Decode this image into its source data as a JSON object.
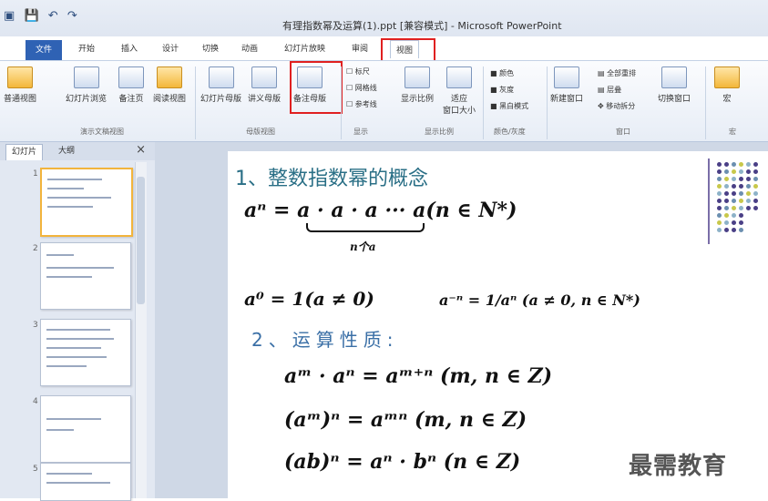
{
  "window": {
    "title": "有理指数幂及运算(1).ppt [兼容模式] - Microsoft PowerPoint"
  },
  "ribbon_tabs": [
    {
      "label": "文件",
      "active": false
    },
    {
      "label": "开始",
      "active": false
    },
    {
      "label": "插入",
      "active": false
    },
    {
      "label": "设计",
      "active": false
    },
    {
      "label": "切换",
      "active": false
    },
    {
      "label": "动画",
      "active": false
    },
    {
      "label": "幻灯片放映",
      "active": false
    },
    {
      "label": "审阅",
      "active": false
    },
    {
      "label": "视图",
      "active": true
    }
  ],
  "ribbon": {
    "normal": "普通视图",
    "sorter": "幻灯片浏览",
    "notes": "备注页",
    "reading": "阅读视图",
    "slide_master": "幻灯片母版",
    "handout_master": "讲义母版",
    "notes_master": "备注母版",
    "ruler": "标尺",
    "gridlines": "网格线",
    "guides": "参考线",
    "zoom": "显示比例",
    "fit_window": "适应",
    "fit_window_2": "窗口大小",
    "color": "颜色",
    "grayscale": "灰度",
    "bw": "黑白模式",
    "new_window": "新建窗口",
    "arrange_all": "全部重排",
    "cascade": "层叠",
    "move_split": "移动拆分",
    "switch_window": "切换窗口",
    "macros": "宏",
    "group_pres_views": "演示文稿视图",
    "group_master_views": "母版视图",
    "group_show": "显示",
    "group_zoom": "显示比例",
    "group_color": "颜色/灰度",
    "group_window": "窗口",
    "group_macros": "宏"
  },
  "left_pane": {
    "tab_slides": "幻灯片",
    "tab_outline": "大纲",
    "close": "×",
    "slide_numbers": [
      "1",
      "2",
      "3",
      "4",
      "5"
    ]
  },
  "slide": {
    "heading1": "1、整数指数幂的概念",
    "eq_power_def": "aⁿ = a · a · a ··· a(n ∈ N*)",
    "underbrace_label": "n个a",
    "eq_zero": "a⁰ = 1(a ≠ 0)",
    "eq_negative": "a⁻ⁿ = 1/aⁿ (a ≠ 0, n ∈ N*)",
    "heading2": "2、运算性质:",
    "rule1": "aᵐ · aⁿ = aᵐ⁺ⁿ (m, n ∈ Z)",
    "rule2": "(aᵐ)ⁿ = aᵐⁿ (m, n ∈ Z)",
    "rule3": "(ab)ⁿ = aⁿ · bⁿ (n ∈ Z)"
  },
  "watermark": "最需教育",
  "colors": {
    "highlight_box": "#e02020",
    "heading_color": "#2a6f86",
    "file_tab": "#2f62b4"
  }
}
